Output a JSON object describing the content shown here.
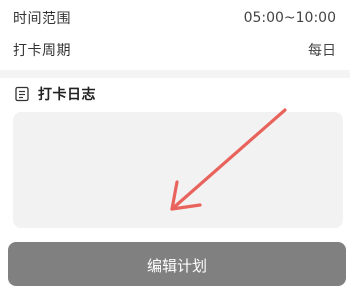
{
  "plan_details": {
    "time_range": {
      "label": "时间范围",
      "value": "05:00~10:00"
    },
    "checkin_cycle": {
      "label": "打卡周期",
      "value": "每日"
    }
  },
  "checkin_log": {
    "icon": "document-icon",
    "title": "打卡日志"
  },
  "annotation": {
    "icon": "arrow-icon",
    "color": "#e9635d"
  },
  "actions": {
    "edit_plan_label": "编辑计划",
    "button_color": "#808080"
  }
}
